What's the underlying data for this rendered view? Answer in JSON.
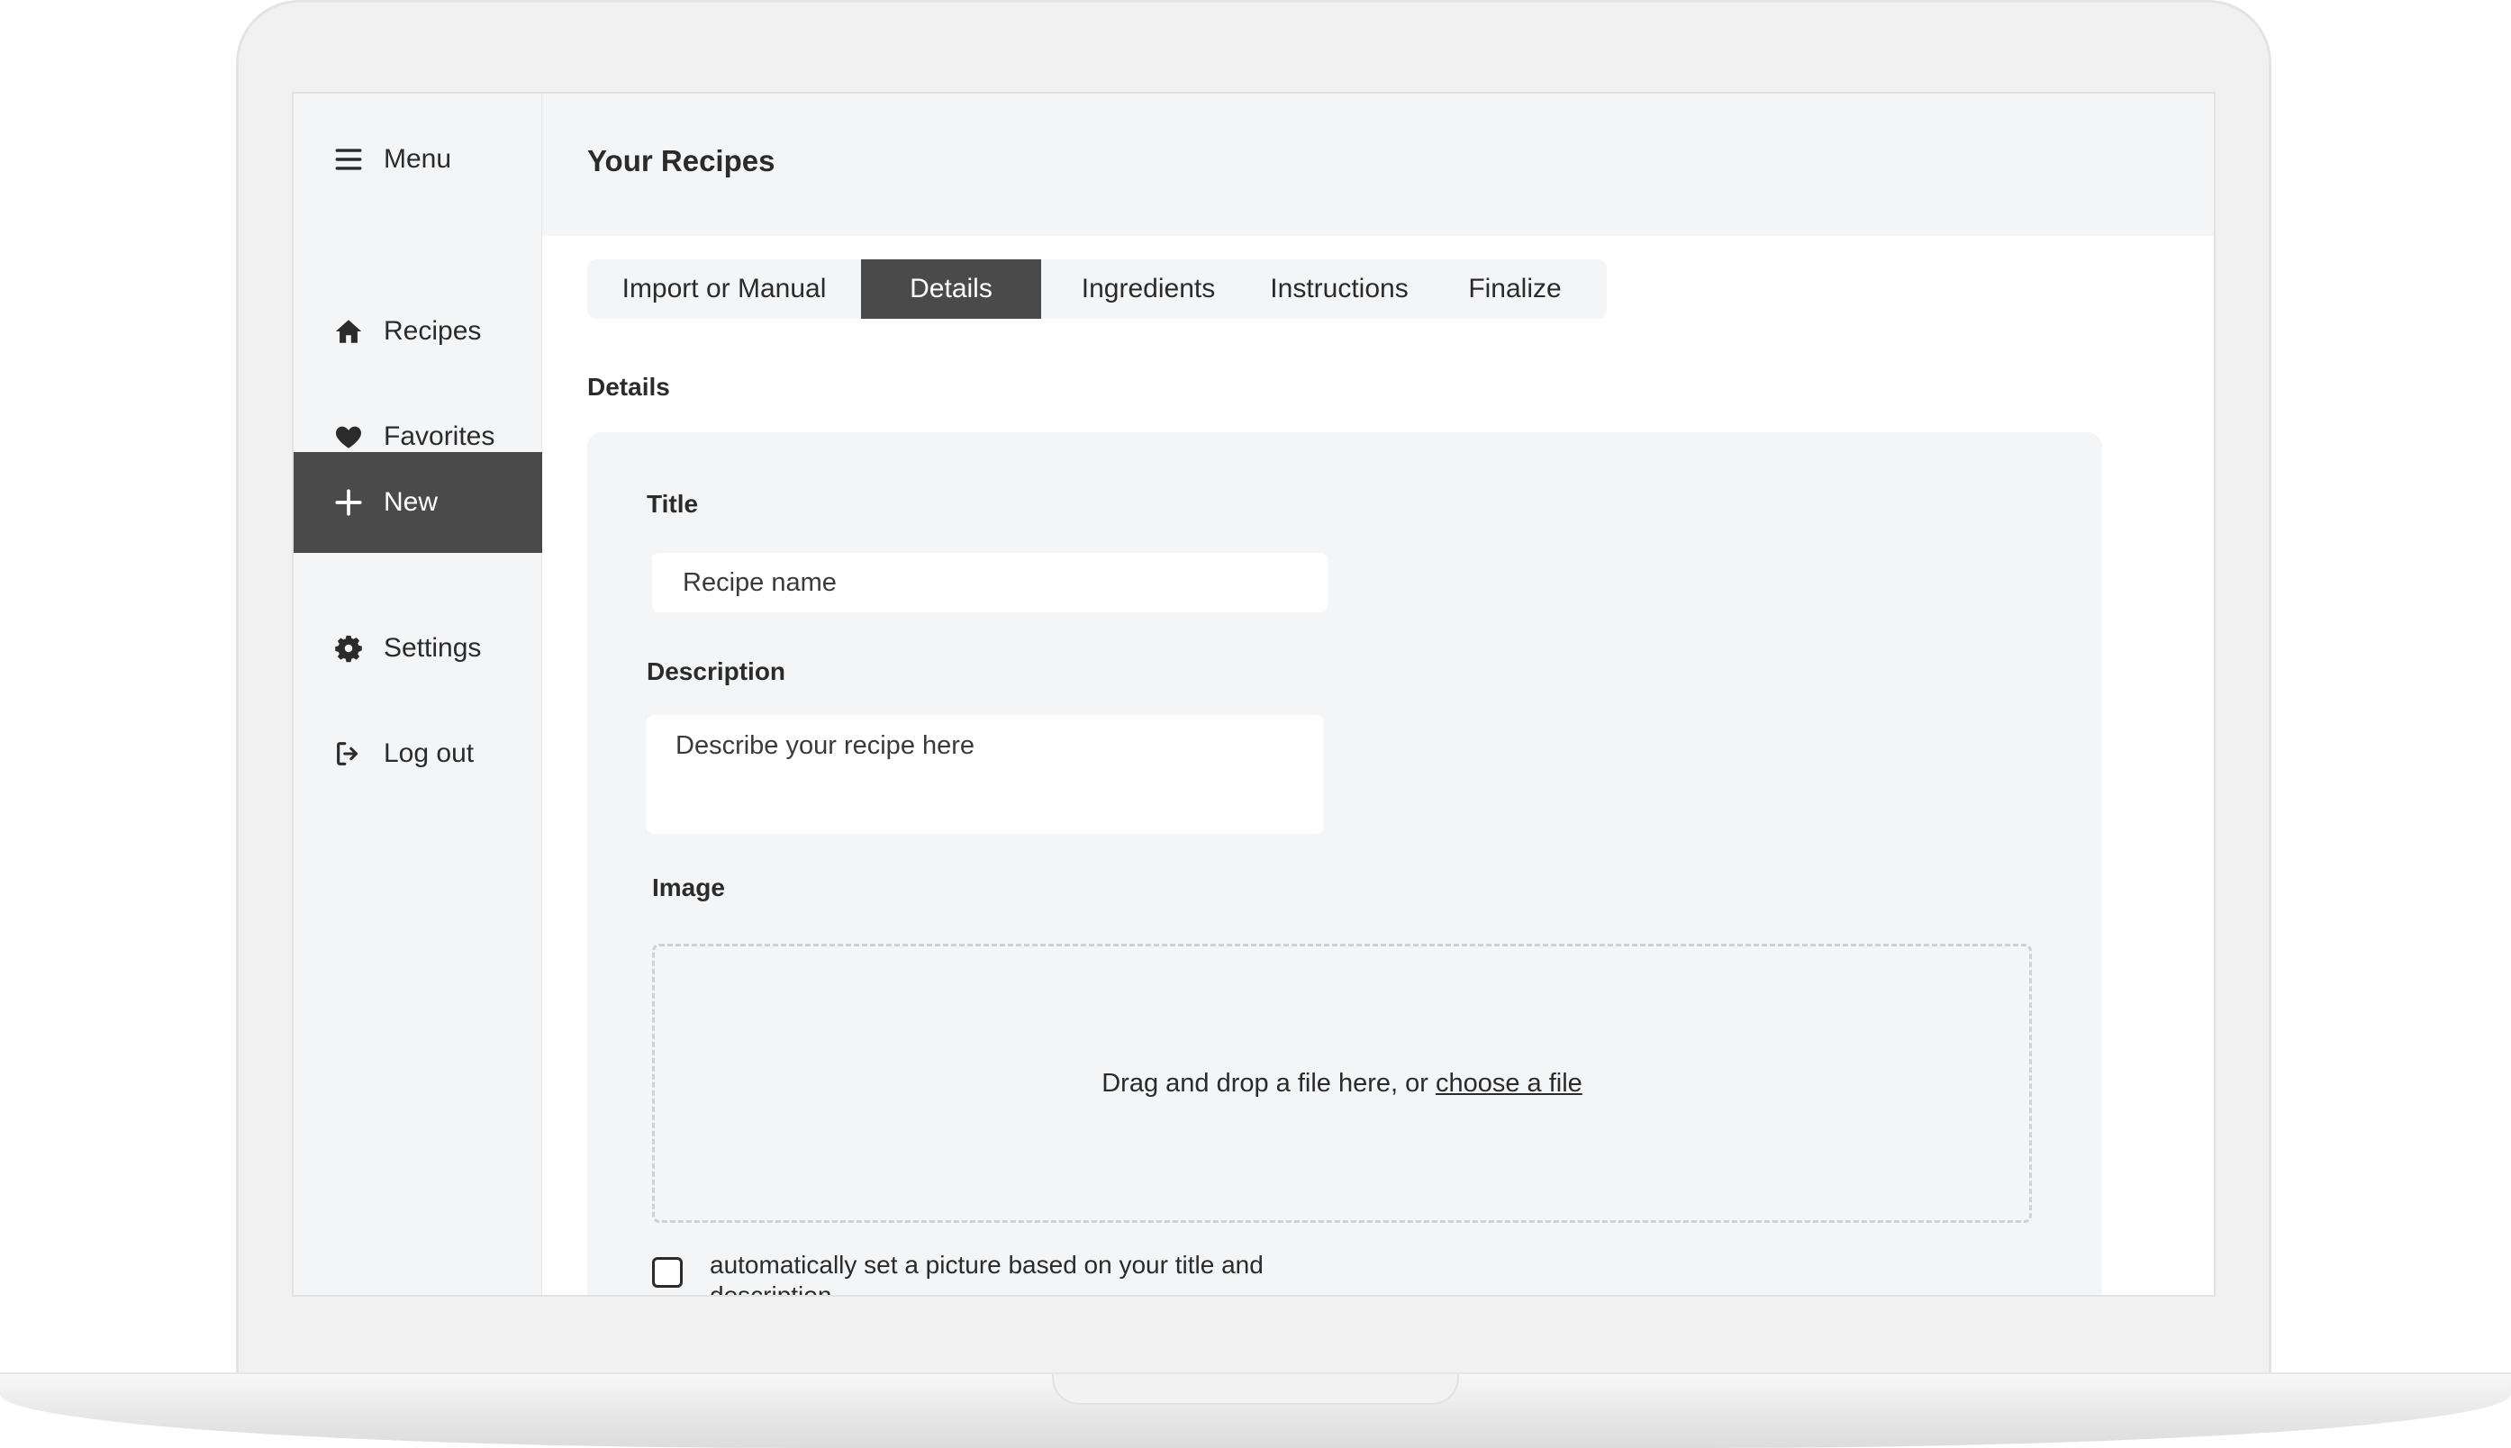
{
  "header": {
    "menu_label": "Menu",
    "title": "Your Recipes"
  },
  "sidebar": {
    "items": [
      {
        "label": "Recipes",
        "icon": "home-icon",
        "active": false
      },
      {
        "label": "Favorites",
        "icon": "heart-icon",
        "active": false
      },
      {
        "label": "New",
        "icon": "plus-icon",
        "active": true
      },
      {
        "label": "Settings",
        "icon": "gear-icon",
        "active": false
      },
      {
        "label": "Log out",
        "icon": "logout-icon",
        "active": false
      }
    ]
  },
  "tabs": [
    {
      "label": "Import or Manual",
      "active": false
    },
    {
      "label": "Details",
      "active": true
    },
    {
      "label": "Ingredients",
      "active": false
    },
    {
      "label": "Instructions",
      "active": false
    },
    {
      "label": "Finalize",
      "active": false
    }
  ],
  "details": {
    "section_title": "Details",
    "title_label": "Title",
    "title_placeholder": "Recipe name",
    "description_label": "Description",
    "description_placeholder": "Describe your recipe here",
    "image_label": "Image",
    "dropzone_text": "Drag and drop a file here, or",
    "dropzone_link": "choose a file",
    "auto_picture_label": "automatically set a picture based on your title and description"
  },
  "colors": {
    "active_bg": "#4a4a4a",
    "surface": "#f4f5f6",
    "text": "#2b2b2b"
  }
}
